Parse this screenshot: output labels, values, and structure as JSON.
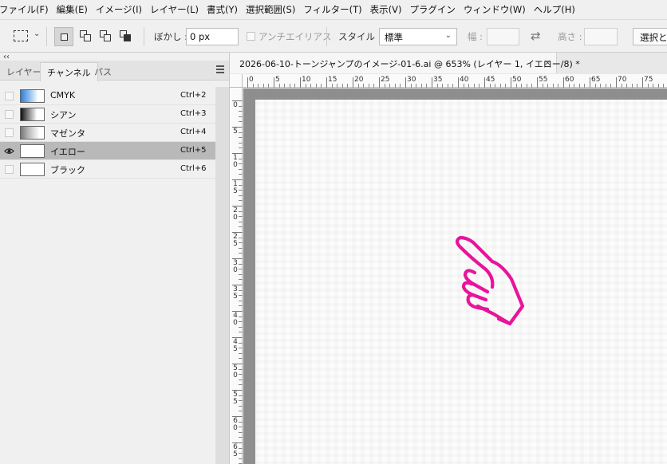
{
  "menubar": {
    "items": [
      "ファイル(F)",
      "編集(E)",
      "イメージ(I)",
      "レイヤー(L)",
      "書式(Y)",
      "選択範囲(S)",
      "フィルター(T)",
      "表示(V)",
      "プラグイン",
      "ウィンドウ(W)",
      "ヘルプ(H)"
    ]
  },
  "options": {
    "feather_label": "ぼかし :",
    "feather_value": "0 px",
    "antialias_label": "アンチエイリアス",
    "style_label": "スタイル :",
    "style_value": "標準",
    "width_label": "幅 :",
    "height_label": "高さ :",
    "select_button": "選択とマスク..."
  },
  "panel": {
    "collapse_glyph": "‹‹",
    "tabs": [
      "レイヤー",
      "チャンネル",
      "パス"
    ],
    "active_tab": "チャンネル",
    "channels": [
      {
        "name": "CMYK",
        "shortcut": "Ctrl+2",
        "visible": false,
        "selected": false
      },
      {
        "name": "シアン",
        "shortcut": "Ctrl+3",
        "visible": false,
        "selected": false
      },
      {
        "name": "マゼンタ",
        "shortcut": "Ctrl+4",
        "visible": false,
        "selected": false
      },
      {
        "name": "イエロー",
        "shortcut": "Ctrl+5",
        "visible": true,
        "selected": true
      },
      {
        "name": "ブラック",
        "shortcut": "Ctrl+6",
        "visible": false,
        "selected": false
      }
    ]
  },
  "document": {
    "tab_title": "2026-06-10-トーンジャンプのイメージ-01-6.ai @ 653% (レイヤー 1, イエロー/8) *",
    "close_glyph": "×"
  },
  "rulers": {
    "horizontal_labels": [
      "0",
      "5",
      "10",
      "15",
      "20",
      "25",
      "30",
      "35",
      "40",
      "45",
      "50",
      "55",
      "60",
      "65",
      "70",
      "75"
    ],
    "vertical_labels": [
      "0",
      "5",
      "10",
      "15",
      "20",
      "25",
      "30",
      "35",
      "40",
      "45",
      "50",
      "55",
      "60",
      "65"
    ]
  },
  "colors": {
    "accent_magenta": "#e8149b",
    "canvas_border": "#8e8e8e",
    "selected_row": "#b9b9b9"
  },
  "icons": {
    "marquee": "rect-marquee-icon",
    "swap": "swap-arrows-icon",
    "eye": "eye-icon",
    "hand": "pointing-hand-illustration"
  }
}
